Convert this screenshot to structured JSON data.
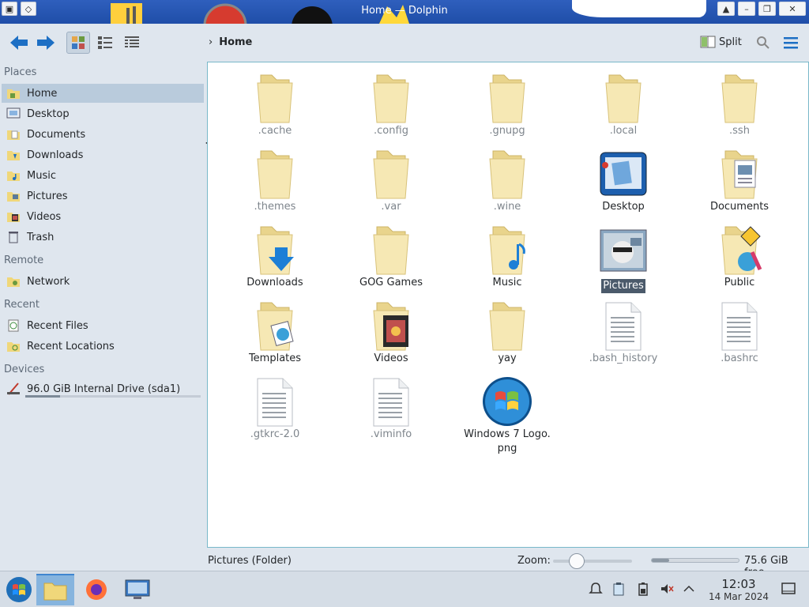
{
  "window": {
    "title": "Home — Dolphin"
  },
  "toolbar": {
    "breadcrumb_current": "Home",
    "split_label": "Split"
  },
  "sidebar": {
    "sections": {
      "places": "Places",
      "remote": "Remote",
      "recent": "Recent",
      "devices": "Devices"
    },
    "places": [
      {
        "label": "Home",
        "icon": "home-folder-icon",
        "selected": true
      },
      {
        "label": "Desktop",
        "icon": "desktop-icon"
      },
      {
        "label": "Documents",
        "icon": "documents-folder-icon"
      },
      {
        "label": "Downloads",
        "icon": "downloads-folder-icon"
      },
      {
        "label": "Music",
        "icon": "music-folder-icon"
      },
      {
        "label": "Pictures",
        "icon": "pictures-folder-icon"
      },
      {
        "label": "Videos",
        "icon": "videos-folder-icon"
      },
      {
        "label": "Trash",
        "icon": "trash-icon"
      }
    ],
    "remote": [
      {
        "label": "Network",
        "icon": "network-icon"
      }
    ],
    "recent": [
      {
        "label": "Recent Files",
        "icon": "recent-files-icon"
      },
      {
        "label": "Recent Locations",
        "icon": "recent-locations-icon"
      }
    ],
    "devices": [
      {
        "label": "96.0 GiB Internal Drive (sda1)",
        "icon": "drive-icon",
        "usage_fraction": 0.2
      }
    ]
  },
  "files": [
    {
      "name": ".cache",
      "type": "folder",
      "hidden": true
    },
    {
      "name": ".config",
      "type": "folder",
      "hidden": true
    },
    {
      "name": ".gnupg",
      "type": "folder",
      "hidden": true
    },
    {
      "name": ".local",
      "type": "folder",
      "hidden": true
    },
    {
      "name": ".ssh",
      "type": "folder",
      "hidden": true
    },
    {
      "name": ".themes",
      "type": "folder",
      "hidden": true
    },
    {
      "name": ".var",
      "type": "folder",
      "hidden": true
    },
    {
      "name": ".wine",
      "type": "folder",
      "hidden": true
    },
    {
      "name": "Desktop",
      "type": "desktop"
    },
    {
      "name": "Documents",
      "type": "documents"
    },
    {
      "name": "Downloads",
      "type": "downloads"
    },
    {
      "name": "GOG Games",
      "type": "folder"
    },
    {
      "name": "Music",
      "type": "music"
    },
    {
      "name": "Pictures",
      "type": "pictures",
      "selected": true
    },
    {
      "name": "Public",
      "type": "public"
    },
    {
      "name": "Templates",
      "type": "templates"
    },
    {
      "name": "Videos",
      "type": "videos"
    },
    {
      "name": "yay",
      "type": "folder"
    },
    {
      "name": ".bash_history",
      "type": "text",
      "hidden": true
    },
    {
      "name": ".bashrc",
      "type": "text",
      "hidden": true
    },
    {
      "name": ".gtkrc-2.0",
      "type": "text",
      "hidden": true
    },
    {
      "name": ".viminfo",
      "type": "text",
      "hidden": true
    },
    {
      "name": "Windows 7 Logo.\npng",
      "type": "image"
    }
  ],
  "statusbar": {
    "selection": "Pictures (Folder)",
    "zoom_label": "Zoom:",
    "zoom_level": 0.3,
    "free_space": "75.6 GiB free",
    "used_fraction": 0.2
  },
  "taskbar": {
    "time": "12:03",
    "date": "14 Mar 2024"
  },
  "colors": {
    "selection": "#b9cbdc",
    "accent": "#1d6fc4",
    "view_border": "#79b8c9"
  }
}
